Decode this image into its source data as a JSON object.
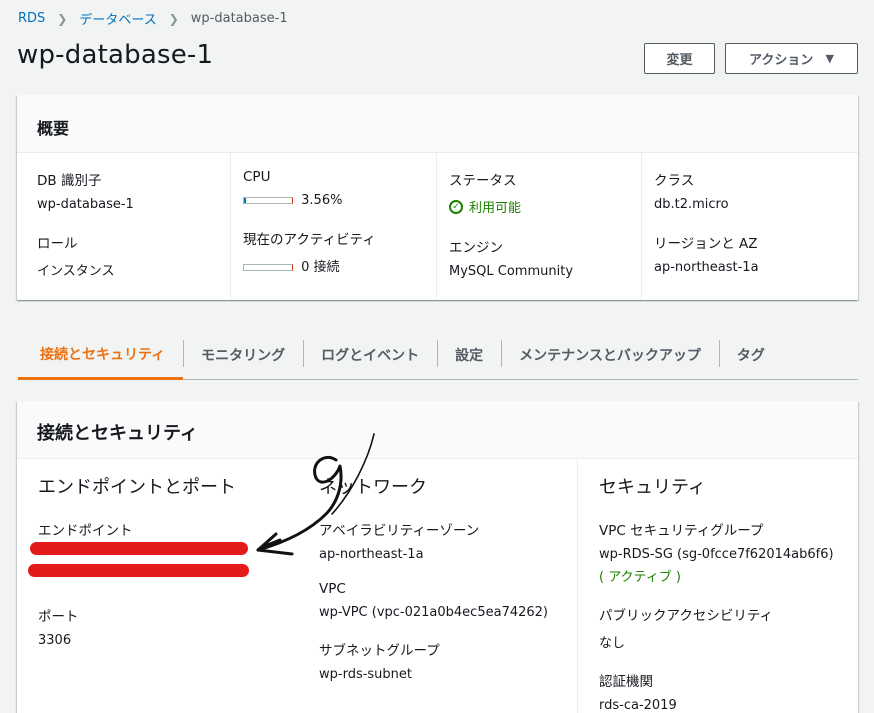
{
  "breadcrumb": {
    "root": "RDS",
    "parent": "データベース",
    "current": "wp-database-1"
  },
  "title": "wp-database-1",
  "buttons": {
    "edit": "変更",
    "actions": "アクション"
  },
  "summary": {
    "header": "概要",
    "fields": {
      "db_identifier": {
        "label": "DB 識別子",
        "value": "wp-database-1"
      },
      "role": {
        "label": "ロール",
        "value": "インスタンス"
      },
      "cpu": {
        "label": "CPU",
        "value": "3.56%",
        "level": 0.0356
      },
      "activity": {
        "label": "現在のアクティビティ",
        "value": "0 接続",
        "level": 0
      },
      "status": {
        "label": "ステータス",
        "value": "利用可能"
      },
      "engine": {
        "label": "エンジン",
        "value": "MySQL Community"
      },
      "class": {
        "label": "クラス",
        "value": "db.t2.micro"
      },
      "region": {
        "label": "リージョンと AZ",
        "value": "ap-northeast-1a"
      }
    }
  },
  "tabs": [
    "接続とセキュリティ",
    "モニタリング",
    "ログとイベント",
    "設定",
    "メンテナンスとバックアップ",
    "タグ"
  ],
  "connectivity": {
    "header": "接続とセキュリティ",
    "endpoint_section": {
      "title": "エンドポイントとポート",
      "endpoint_label": "エンドポイント",
      "port_label": "ポート",
      "port_value": "3306"
    },
    "network_section": {
      "title": "ネットワーク",
      "az_label": "アベイラビリティーゾーン",
      "az_value": "ap-northeast-1a",
      "vpc_label": "VPC",
      "vpc_value": "wp-VPC (vpc-021a0b4ec5ea74262)",
      "subnet_label": "サブネットグループ",
      "subnet_value": "wp-rds-subnet"
    },
    "security_section": {
      "title": "セキュリティ",
      "sg_label": "VPC セキュリティグループ",
      "sg_value": "wp-RDS-SG (sg-0fcce7f62014ab6f6)",
      "sg_status": "( アクティブ )",
      "public_label": "パブリックアクセシビリティ",
      "public_value": "なし",
      "ca_label": "認証機関",
      "ca_value": "rds-ca-2019"
    }
  },
  "colors": {
    "accent": "#ec7211",
    "link": "#0073bb",
    "success": "#1d8102",
    "annotation": "#e41b1b"
  }
}
